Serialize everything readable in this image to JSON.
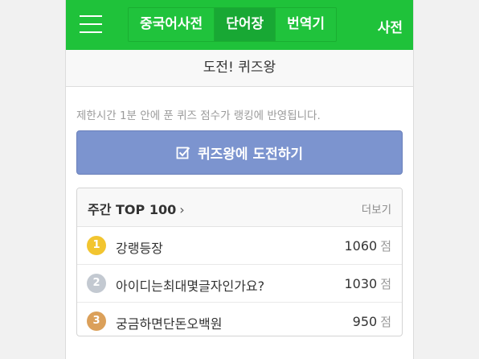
{
  "header": {
    "tabs": [
      {
        "label": "중국어사전",
        "active": false
      },
      {
        "label": "단어장",
        "active": true
      },
      {
        "label": "번역기",
        "active": false
      }
    ],
    "dict_link": "사전",
    "accent_color": "#1fc23a"
  },
  "subheader": {
    "title": "도전! 퀴즈왕"
  },
  "notice": "제한시간 1분 안에 푼 퀴즈 점수가 랭킹에 반영됩니다.",
  "challenge": {
    "label": "퀴즈왕에 도전하기",
    "icon": "checkbox-icon",
    "color": "#7c94cf"
  },
  "ranking": {
    "title": "주간 TOP 100",
    "chevron": "›",
    "more_label": "더보기",
    "score_unit": "점",
    "rows": [
      {
        "rank": "1",
        "name": "강랭등장",
        "score": "1060",
        "medal_color": "#f2c530"
      },
      {
        "rank": "2",
        "name": "아이디는최대몇글자인가요?",
        "score": "1030",
        "medal_color": "#c3c9d1"
      },
      {
        "rank": "3",
        "name": "궁금하면단돈오백원",
        "score": "950",
        "medal_color": "#dba05a"
      }
    ]
  }
}
